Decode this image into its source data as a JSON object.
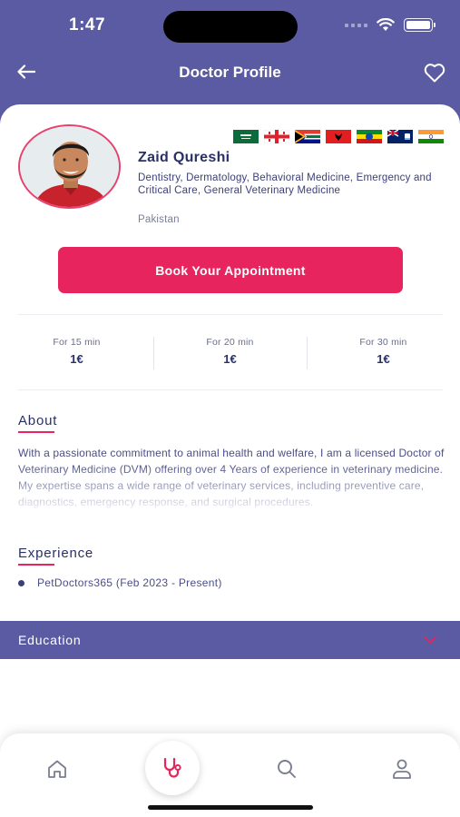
{
  "status_bar": {
    "time": "1:47"
  },
  "header": {
    "title": "Doctor Profile"
  },
  "icons": {
    "back": "arrow-left-icon",
    "favorite": "heart-icon",
    "home": "home-icon",
    "appointments": "stethoscope-icon",
    "search": "search-icon",
    "profile": "user-icon",
    "chevron": "chevron-down-icon"
  },
  "doctor": {
    "name": "Zaid Qureshi",
    "specialties": "Dentistry, Dermatology, Behavioral Medicine, Emergency and Critical Care, General Veterinary Medicine",
    "country": "Pakistan",
    "flags": [
      "saudi-arabia-flag",
      "georgia-flag",
      "south-africa-flag",
      "albania-flag",
      "ethiopia-flag",
      "anguilla-flag",
      "india-flag"
    ]
  },
  "actions": {
    "book_label": "Book Your Appointment"
  },
  "pricing": [
    {
      "label": "For 15 min",
      "price": "1€"
    },
    {
      "label": "For 20 min",
      "price": "1€"
    },
    {
      "label": "For 30 min",
      "price": "1€"
    }
  ],
  "about": {
    "title": "About",
    "text": "With a passionate commitment to animal health and welfare, I am a licensed Doctor of Veterinary Medicine (DVM) offering over 4 Years of experience in veterinary medicine. My expertise spans a wide range of veterinary services, including preventive care, diagnostics, emergency response, and surgical procedures."
  },
  "experience": {
    "title": "Experience",
    "items": [
      {
        "text": "PetDoctors365 (Feb 2023 - Present)"
      }
    ]
  },
  "education": {
    "title": "Education"
  },
  "colors": {
    "primary": "#5B5BA3",
    "accent": "#E8245E",
    "text_dark": "#2A2F66",
    "text_body": "#4A4E88"
  }
}
